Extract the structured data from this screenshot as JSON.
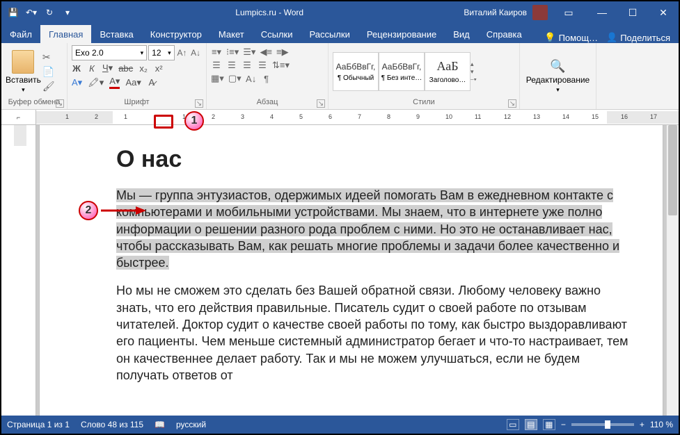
{
  "titlebar": {
    "title": "Lumpics.ru - Word",
    "user": "Виталий Каиров"
  },
  "tabs": {
    "file": "Файл",
    "home": "Главная",
    "insert": "Вставка",
    "design": "Конструктор",
    "layout": "Макет",
    "references": "Ссылки",
    "mailings": "Рассылки",
    "review": "Рецензирование",
    "view": "Вид",
    "help": "Справка",
    "tell": "Помощ…",
    "share": "Поделиться"
  },
  "ribbon": {
    "clipboard": {
      "paste": "Вставить",
      "label": "Буфер обмена"
    },
    "font": {
      "name": "Exo 2.0",
      "size": "12",
      "label": "Шрифт"
    },
    "paragraph": {
      "label": "Абзац"
    },
    "styles": {
      "label": "Стили",
      "items": [
        {
          "prev": "АаБбВвГг,",
          "name": "¶ Обычный"
        },
        {
          "prev": "АаБбВвГг,",
          "name": "¶ Без инте…"
        },
        {
          "prev": "АаБ",
          "name": "Заголово…"
        }
      ]
    },
    "editing": {
      "label": "Редактирование"
    }
  },
  "ruler": {
    "nums": [
      " ",
      "1",
      "2",
      "1",
      " ",
      "1",
      "2",
      "3",
      "4",
      "5",
      "6",
      "7",
      "8",
      "9",
      "10",
      "11",
      "12",
      "13",
      "14",
      "15",
      "16",
      "17"
    ]
  },
  "doc": {
    "heading": "О нас",
    "p1": "Мы — группа энтузиастов, одержимых идеей помогать Вам в ежедневном контакте с компьютерами и мобильными устройствами. Мы знаем, что в интернете уже полно информации о решении разного рода проблем с ними. Но это не останавливает нас, чтобы рассказывать Вам, как решать многие проблемы и задачи более качественно и быстрее.",
    "p2": "Но мы не сможем это сделать без Вашей обратной связи. Любому человеку важно знать, что его действия правильные. Писатель судит о своей работе по отзывам читателей. Доктор судит о качестве своей работы по тому, как быстро выздоравливают его пациенты. Чем меньше системный администратор бегает и что-то настраивает, тем он качественнее делает работу. Так и мы не можем улучшаться, если не будем получать ответов от"
  },
  "status": {
    "page": "Страница 1 из 1",
    "words": "Слово 48 из 115",
    "lang": "русский",
    "zoom": "110 %"
  },
  "callouts": {
    "c1": "1",
    "c2": "2"
  }
}
